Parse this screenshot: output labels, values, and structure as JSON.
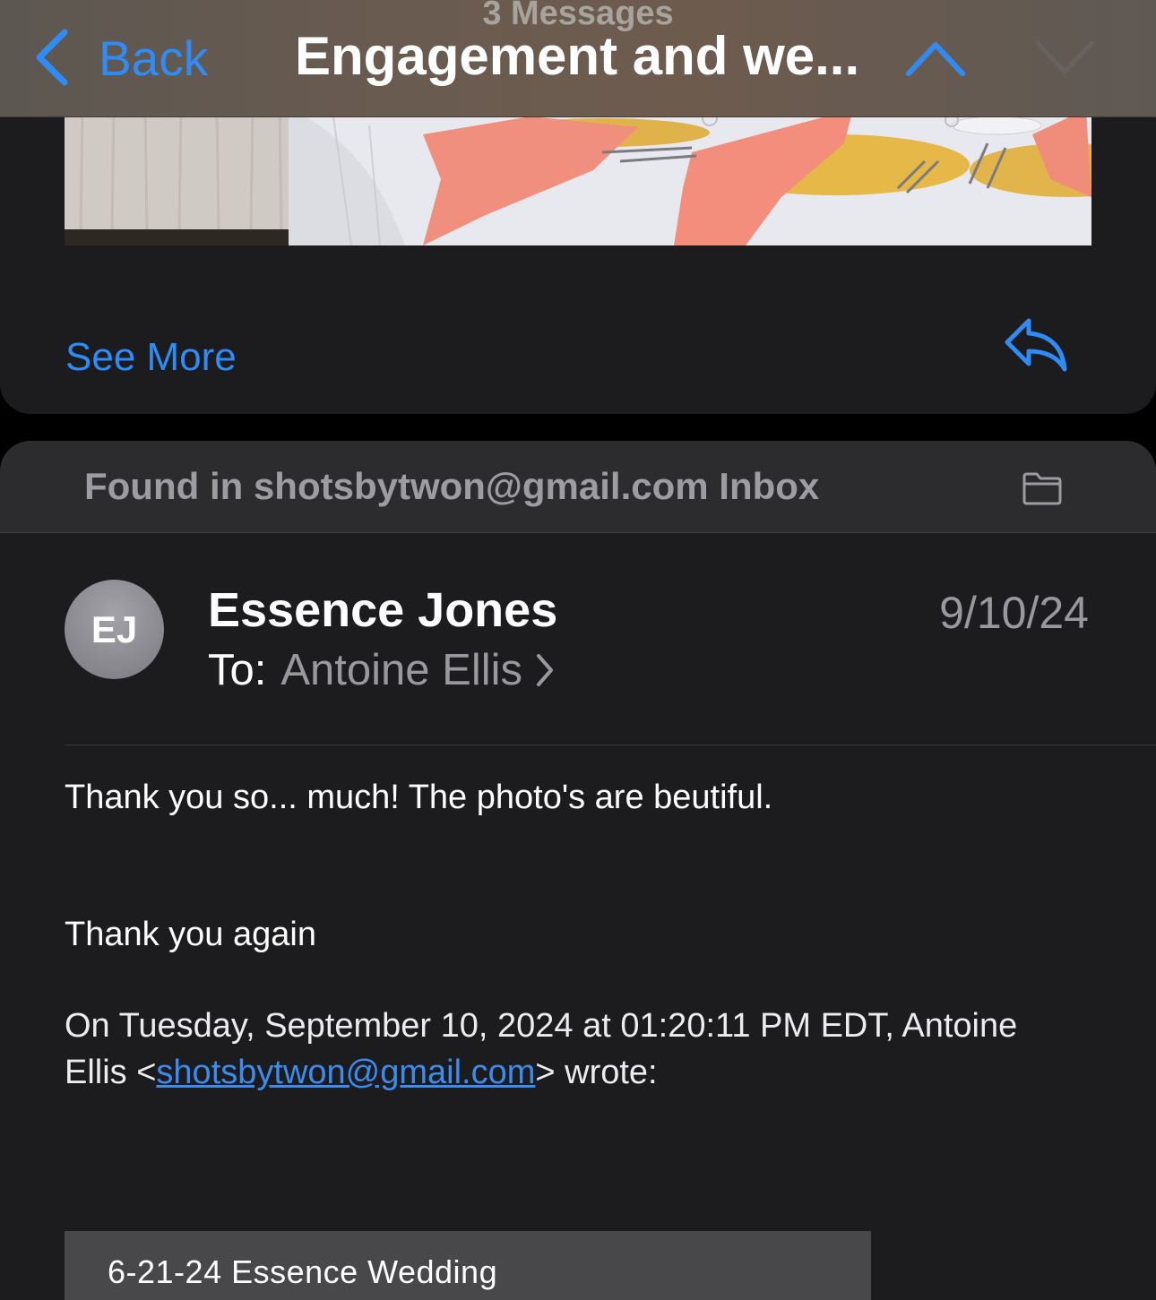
{
  "nav": {
    "message_count": "3 Messages",
    "back_label": "Back",
    "title": "Engagement and we...",
    "icons": [
      "chevron-left-icon",
      "chevron-up-icon",
      "chevron-down-icon"
    ],
    "accent_color": "#2f8cf6"
  },
  "previous_message": {
    "see_more_label": "See More",
    "reply_icon": "reply-icon"
  },
  "mailbox": {
    "found_in_label": "Found in shotsbytwon@gmail.com Inbox",
    "folder_icon": "folder-icon"
  },
  "message": {
    "avatar_initials": "EJ",
    "sender": "Essence Jones",
    "to_label": "To:",
    "recipient": "Antoine Ellis",
    "date": "9/10/24",
    "body": [
      "Thank you so... much! The photo's are beutiful.",
      "Thank you again"
    ],
    "quote_prefix": "On Tuesday, September 10, 2024 at 01:20:11 PM EDT, Antoine Ellis <",
    "quote_email": "shotsbytwon@gmail.com",
    "quote_suffix": "> wrote:",
    "album_title": "6-21-24 Essence Wedding"
  }
}
